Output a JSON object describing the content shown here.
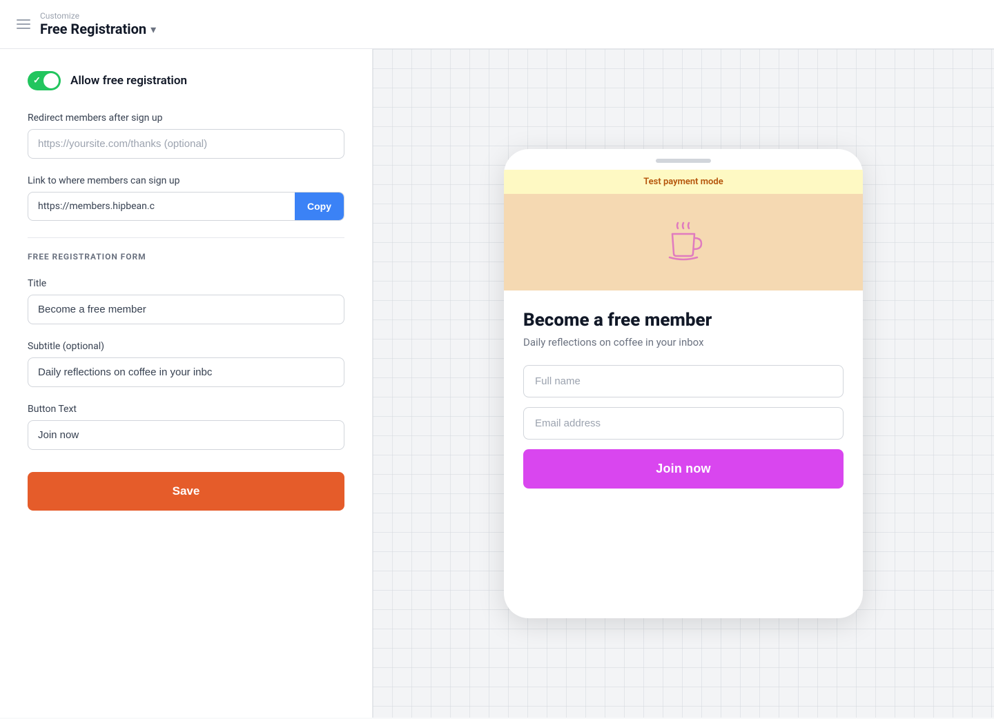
{
  "header": {
    "customize_label": "Customize",
    "page_title": "Free Registration",
    "chevron": "▾",
    "menu_icon": "hamburger"
  },
  "left": {
    "toggle": {
      "enabled": true,
      "label": "Allow free registration"
    },
    "redirect": {
      "label": "Redirect members after sign up",
      "placeholder": "https://yoursite.com/thanks (optional)"
    },
    "signup_link": {
      "label": "Link to where members can sign up",
      "url": "https://members.hipbean.c",
      "copy_label": "Copy"
    },
    "section_heading": "FREE REGISTRATION FORM",
    "title_field": {
      "label": "Title",
      "value": "Become a free member"
    },
    "subtitle_field": {
      "label": "Subtitle (optional)",
      "value": "Daily reflections on coffee in your inbc"
    },
    "button_text_field": {
      "label": "Button Text",
      "value": "Join now"
    },
    "save_button": "Save"
  },
  "right": {
    "test_payment_banner": "Test payment mode",
    "preview": {
      "title": "Become a free member",
      "subtitle": "Daily reflections on coffee in your inbox",
      "full_name_placeholder": "Full name",
      "email_placeholder": "Email address",
      "join_button": "Join now"
    }
  }
}
